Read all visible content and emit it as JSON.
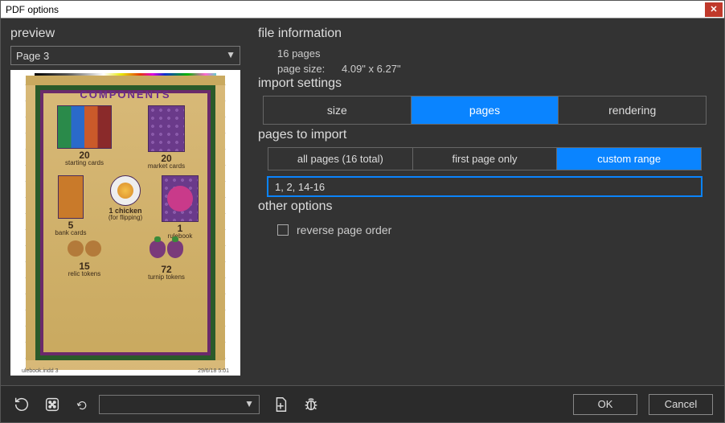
{
  "window": {
    "title": "PDF options"
  },
  "preview": {
    "heading": "preview",
    "page_select": "Page 3",
    "doc": {
      "heading": "COMPONENTS",
      "items": {
        "starting": {
          "n": "20",
          "label": "starting cards"
        },
        "market": {
          "n": "20",
          "label": "market cards"
        },
        "bank": {
          "n": "5",
          "label": "bank cards"
        },
        "chicken": {
          "n": "1 chicken",
          "label": "(for flipping)"
        },
        "rule": {
          "n": "1",
          "label": "rulebook"
        },
        "relic": {
          "n": "15",
          "label": "relic tokens"
        },
        "turnip": {
          "n": "72",
          "label": "turnip tokens"
        }
      },
      "footer_left": "ulebook.indd 3",
      "footer_right": "29/6/18 5:01"
    }
  },
  "file_info": {
    "heading": "file information",
    "pages": "16 pages",
    "size_label": "page size:",
    "size_value": "4.09\" x 6.27\""
  },
  "import": {
    "heading": "import settings",
    "tabs": {
      "size": "size",
      "pages": "pages",
      "rendering": "rendering"
    }
  },
  "pages_to_import": {
    "heading": "pages to import",
    "opts": {
      "all": "all pages (16 total)",
      "first": "first page only",
      "custom": "custom range"
    },
    "range_value": "1, 2, 14-16"
  },
  "other": {
    "heading": "other options",
    "reverse": "reverse page order"
  },
  "footer": {
    "ok": "OK",
    "cancel": "Cancel"
  }
}
